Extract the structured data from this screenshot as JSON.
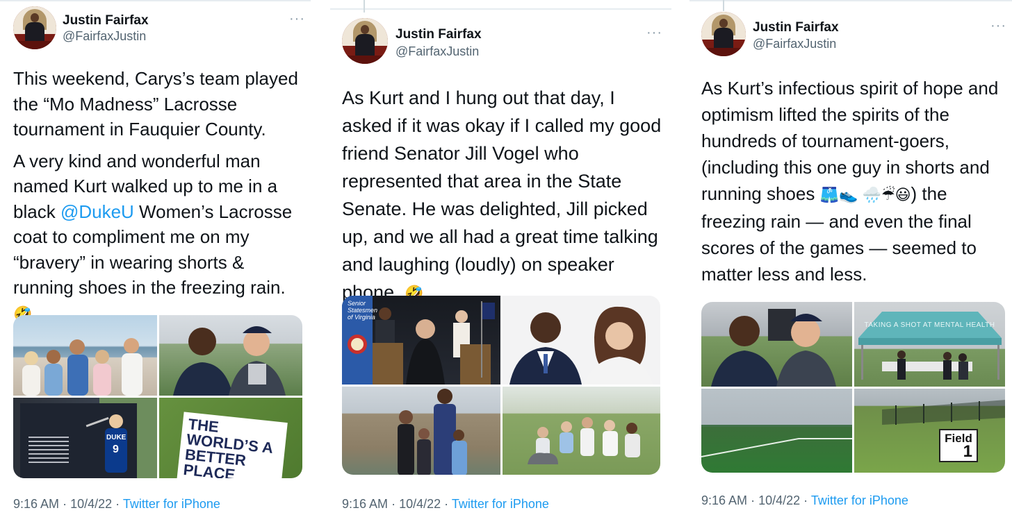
{
  "tweets": [
    {
      "name": "Justin Fairfax",
      "handle": "@FairfaxJustin",
      "more": "···",
      "paragraphs": [
        "This weekend, Carys’s team played the “Mo Madness” Lacrosse tournament in Fauquier County.",
        "A very kind and wonderful man named Kurt walked up to me in a black"
      ],
      "mention": "@DukeU",
      "after_mention": " Women’s Lacrosse coat to compliment me on my “bravery” in wearing shorts & running shoes in the freezing rain. ",
      "emoji": "🤣",
      "time": "9:16 AM",
      "date": "10/4/22",
      "separator": "·",
      "source": "Twitter for iPhone",
      "photos": [
        {
          "name": "family-beach-photo"
        },
        {
          "name": "selfie-with-kurt-photo"
        },
        {
          "name": "field-dedication-plaque-photo",
          "plaque_text": "DUKE",
          "jersey": "9"
        },
        {
          "name": "worlds-a-better-place-sign-photo",
          "sign_text": "THE WORLD’S A BETTER PLACE WITH YOU IN"
        }
      ]
    },
    {
      "name": "Justin Fairfax",
      "handle": "@FairfaxJustin",
      "more": "···",
      "text": "As Kurt and I hung out that day, I asked if it was okay if I called my good friend Senator Jill Vogel who represented that area in the State Senate. He was delighted, Jill picked up, and we all had a great time talking and laughing (loudly) on speaker phone. ",
      "emoji": "🤣",
      "time": "9:16 AM",
      "date": "10/4/22",
      "separator": "·",
      "source": "Twitter for iPhone",
      "photos": [
        {
          "name": "senate-podium-photo",
          "banner_text": "Senior Statesmen of Virginia"
        },
        {
          "name": "fairfax-vogel-portrait-photo"
        },
        {
          "name": "family-at-castle-photo"
        },
        {
          "name": "vogel-family-lawn-photo"
        }
      ]
    },
    {
      "name": "Justin Fairfax",
      "handle": "@FairfaxJustin",
      "more": "···",
      "text_before": "As Kurt’s infectious spirit of hope and optimism lifted the spirits of the hundreds of tournament-goers, (including this one guy in shorts and running shoes ",
      "emojis": "🩳👟 🌧️☔😃",
      "text_after": ") the freezing rain — and even the final scores of the games — seemed to matter less and less.",
      "time": "9:16 AM",
      "date": "10/4/22",
      "separator": "·",
      "source": "Twitter for iPhone",
      "photos": [
        {
          "name": "selfie-with-kurt-photo"
        },
        {
          "name": "mental-health-tent-photo",
          "tent_text": "TAKING A SHOT AT MENTAL HEALTH"
        },
        {
          "name": "empty-lacrosse-field-photo"
        },
        {
          "name": "field-1-sign-photo",
          "sign_text": "Field",
          "sign_number": "1"
        }
      ]
    }
  ],
  "colors": {
    "link": "#1d9bf0",
    "secondary_text": "#536471",
    "primary_text": "#0f1419",
    "divider": "#e6ecf0"
  }
}
